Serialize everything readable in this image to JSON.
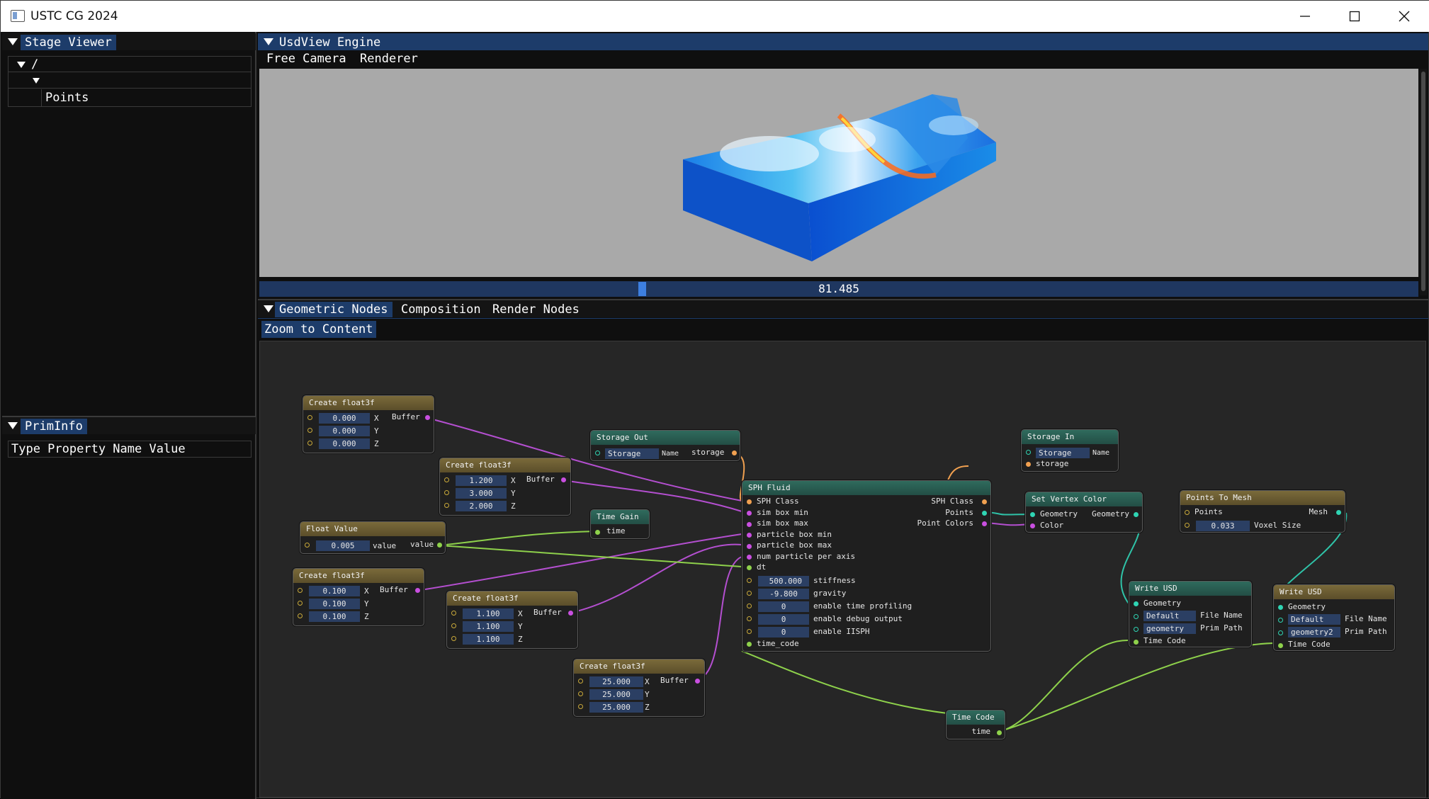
{
  "window": {
    "title": "USTC CG 2024"
  },
  "stage_viewer": {
    "tab": "Stage Viewer",
    "tree": [
      {
        "label": "/"
      },
      {
        "label": ""
      },
      {
        "label": "Points"
      }
    ]
  },
  "prim_info": {
    "tab": "PrimInfo",
    "columns": "Type Property Name Value"
  },
  "usdview": {
    "tab": "UsdView Engine",
    "menu": [
      "Free Camera",
      "Renderer"
    ],
    "timeline_value": "81.485",
    "timeline_fraction": 0.329
  },
  "node_editor": {
    "tabs": [
      "Geometric Nodes",
      "Composition",
      "Render Nodes"
    ],
    "zoom_button": "Zoom to Content"
  },
  "nodes": {
    "cf1": {
      "title": "Create float3f",
      "x": "0.000",
      "y": "0.000",
      "z": "0.000",
      "out": "Buffer"
    },
    "cf2": {
      "title": "Create float3f",
      "x": "1.200",
      "y": "3.000",
      "z": "2.000",
      "out": "Buffer"
    },
    "cf3": {
      "title": "Create float3f",
      "x": "0.100",
      "y": "0.100",
      "z": "0.100",
      "out": "Buffer"
    },
    "cf4": {
      "title": "Create float3f",
      "x": "1.100",
      "y": "1.100",
      "z": "1.100",
      "out": "Buffer"
    },
    "cf5": {
      "title": "Create float3f",
      "x": "25.000",
      "y": "25.000",
      "z": "25.000",
      "out": "Buffer"
    },
    "float_value": {
      "title": "Float Value",
      "value": "0.005",
      "label": "value",
      "out": "value"
    },
    "storage_out": {
      "title": "Storage Out",
      "field": "Storage",
      "name": "Name",
      "out": "storage"
    },
    "time_gain": {
      "title": "Time Gain",
      "out": "time"
    },
    "storage_in": {
      "title": "Storage In",
      "field": "Storage",
      "name": "Name",
      "out": "storage"
    },
    "sph": {
      "title": "SPH Fluid",
      "inputs": [
        "SPH Class",
        "sim box min",
        "sim box max",
        "particle box min",
        "particle box max",
        "num particle per axis",
        "dt"
      ],
      "params": [
        {
          "value": "500.000",
          "label": "stiffness"
        },
        {
          "value": "-9.800",
          "label": "gravity"
        },
        {
          "value": "0",
          "label": "enable time profiling"
        },
        {
          "value": "0",
          "label": "enable debug output"
        },
        {
          "value": "0",
          "label": "enable IISPH"
        }
      ],
      "time_in": "time_code",
      "outputs": [
        "SPH Class",
        "Points",
        "Point Colors"
      ]
    },
    "set_vertex_color": {
      "title": "Set Vertex Color",
      "in1": "Geometry",
      "in2": "Color",
      "out": "Geometry"
    },
    "points_to_mesh": {
      "title": "Points To Mesh",
      "in": "Points",
      "out": "Mesh",
      "value": "0.033",
      "label": "Voxel Size"
    },
    "write_usd1": {
      "title": "Write USD",
      "in": "Geometry",
      "file_value": "Default",
      "file_label": "File Name",
      "prim_value": "geometry",
      "prim_label": "Prim Path",
      "time": "Time Code"
    },
    "write_usd2": {
      "title": "Write USD",
      "in": "Geometry",
      "file_value": "Default",
      "file_label": "File Name",
      "prim_value": "geometry2",
      "prim_label": "Prim Path",
      "time": "Time Code"
    },
    "time_code": {
      "title": "Time Code",
      "out": "time"
    }
  },
  "colors": {
    "accent": "#1d3c6a",
    "node_gold": "#6b5b32",
    "node_teal": "#2a5c50",
    "link_magenta": "#b44fd0",
    "link_green": "#8ed14b",
    "link_teal": "#2fc3a8",
    "link_orange": "#f0a050"
  }
}
